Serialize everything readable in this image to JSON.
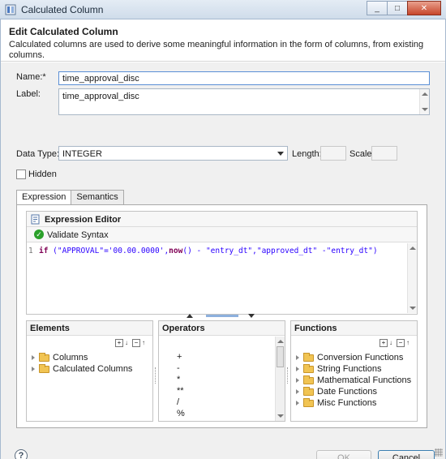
{
  "window": {
    "title": "Calculated Column",
    "icon": "calculated-column-icon",
    "buttons": [
      "minimize",
      "maximize",
      "close"
    ]
  },
  "header": {
    "title": "Edit Calculated Column",
    "description": "Calculated columns are used to derive some meaningful information in the form of columns, from existing columns."
  },
  "form": {
    "name_label": "Name:*",
    "name_value": "time_approval_disc",
    "label_label": "Label:",
    "label_value": "time_approval_disc",
    "data_type_label": "Data Type:",
    "data_type_value": "INTEGER",
    "length_label": "Length:",
    "length_value": "",
    "scale_label": "Scale:",
    "scale_value": "",
    "hidden_label": "Hidden",
    "hidden_checked": false
  },
  "tabs": [
    {
      "label": "Expression",
      "active": true
    },
    {
      "label": "Semantics",
      "active": false
    }
  ],
  "editor": {
    "title": "Expression Editor",
    "validate_label": "Validate Syntax",
    "line_number": "1",
    "code_if": "if",
    "code_str1": " (\"APPROVAL\"='00.00.0000',",
    "code_now": "now",
    "code_str2": "() - \"entry_dt\",\"approved_dt\" -\"entry_dt\")"
  },
  "elements": {
    "title": "Elements",
    "items": [
      "Columns",
      "Calculated Columns"
    ]
  },
  "operators": {
    "title": "Operators",
    "items": [
      "+",
      "-",
      "*",
      "**",
      "/",
      "%"
    ]
  },
  "functions": {
    "title": "Functions",
    "items": [
      "Conversion Functions",
      "String Functions",
      "Mathematical Functions",
      "Date Functions",
      "Misc Functions"
    ]
  },
  "footer": {
    "help": "?",
    "ok_label": "OK",
    "cancel_label": "Cancel"
  }
}
